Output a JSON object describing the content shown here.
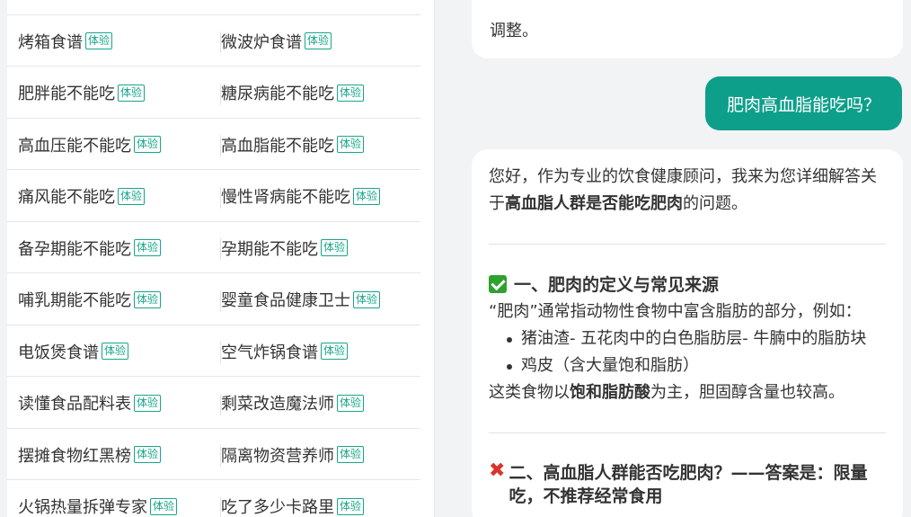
{
  "tools": [
    [
      {
        "label": "烤箱食谱",
        "badge": "体验"
      },
      {
        "label": "微波炉食谱",
        "badge": "体验"
      }
    ],
    [
      {
        "label": "肥胖能不能吃",
        "badge": "体验"
      },
      {
        "label": "糖尿病能不能吃",
        "badge": "体验"
      }
    ],
    [
      {
        "label": "高血压能不能吃",
        "badge": "体验"
      },
      {
        "label": "高血脂能不能吃",
        "badge": "体验"
      }
    ],
    [
      {
        "label": "痛风能不能吃",
        "badge": "体验"
      },
      {
        "label": "慢性肾病能不能吃",
        "badge": "体验"
      }
    ],
    [
      {
        "label": "备孕期能不能吃",
        "badge": "体验"
      },
      {
        "label": "孕期能不能吃",
        "badge": "体验"
      }
    ],
    [
      {
        "label": "哺乳期能不能吃",
        "badge": "体验"
      },
      {
        "label": "婴童食品健康卫士",
        "badge": "体验"
      }
    ],
    [
      {
        "label": "电饭煲食谱",
        "badge": "体验"
      },
      {
        "label": "空气炸锅食谱",
        "badge": "体验"
      }
    ],
    [
      {
        "label": "读懂食品配料表",
        "badge": "体验"
      },
      {
        "label": "剩菜改造魔法师",
        "badge": "体验"
      }
    ],
    [
      {
        "label": "摆摊食物红黑榜",
        "badge": "体验"
      },
      {
        "label": "隔离物资营养师",
        "badge": "体验"
      }
    ],
    [
      {
        "label": "火锅热量拆弹专家",
        "badge": "体验"
      },
      {
        "label": "吃了多少卡路里",
        "badge": "体验"
      }
    ]
  ],
  "chat": {
    "prev_tail": "调整。",
    "user_message": "肥肉高血脂能吃吗？",
    "answer": {
      "intro_1": "您好，作为专业的饮食健康顾问，我来为您详细解答关于",
      "intro_bold": "高血脂人群是否能吃肥肉",
      "intro_2": "的问题。",
      "section1_title": "一、肥肉的定义与常见来源",
      "section1_text": "“肥肉”通常指动物性食物中富含脂肪的部分，例如：",
      "bullets": [
        "猪油渣- 五花肉中的白色脂肪层- 牛腩中的脂肪块",
        "鸡皮（含大量饱和脂肪）"
      ],
      "section1_tail_1": "这类食物以",
      "section1_tail_bold": "饱和脂肪酸",
      "section1_tail_2": "为主，胆固醇含量也较高。",
      "section2_title": "二、高血脂人群能否吃肥肉？——答案是：限量吃，不推荐经常食用"
    }
  },
  "colors": {
    "accent": "#0e9f8b",
    "badge": "#17a589",
    "check": "#2fa12f",
    "cross": "#d9342b"
  },
  "icons": {
    "section1": "check-mark-icon",
    "section2": "cross-mark-icon"
  }
}
